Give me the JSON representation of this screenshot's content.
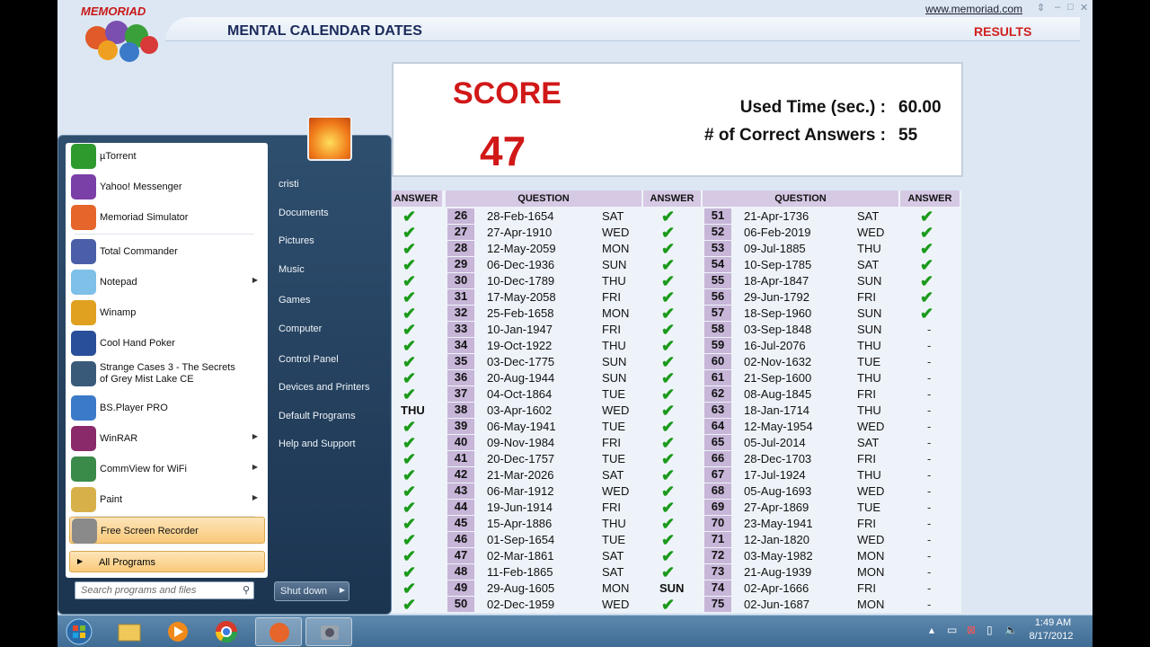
{
  "app": {
    "logo_text": "MEMORIAD",
    "title": "MENTAL CALENDAR DATES",
    "results_label": "RESULTS",
    "site_link": "www.memoriad.com"
  },
  "score": {
    "label": "SCORE",
    "value": "47",
    "time_label": "Used Time (sec.) :",
    "time_value": "60.00",
    "correct_label": "# of Correct Answers :",
    "correct_value": "55"
  },
  "table": {
    "headers": [
      "ANSWER",
      "QUESTION",
      "ANSWER",
      "QUESTION",
      "ANSWER"
    ],
    "rows": [
      {
        "a1": "✔",
        "n1": "26",
        "d1": "28-Feb-1654",
        "w1": "SAT",
        "a2": "✔",
        "n2": "51",
        "d2": "21-Apr-1736",
        "w2": "SAT",
        "a3": "✔"
      },
      {
        "a1": "✔",
        "n1": "27",
        "d1": "27-Apr-1910",
        "w1": "WED",
        "a2": "✔",
        "n2": "52",
        "d2": "06-Feb-2019",
        "w2": "WED",
        "a3": "✔"
      },
      {
        "a1": "✔",
        "n1": "28",
        "d1": "12-May-2059",
        "w1": "MON",
        "a2": "✔",
        "n2": "53",
        "d2": "09-Jul-1885",
        "w2": "THU",
        "a3": "✔"
      },
      {
        "a1": "✔",
        "n1": "29",
        "d1": "06-Dec-1936",
        "w1": "SUN",
        "a2": "✔",
        "n2": "54",
        "d2": "10-Sep-1785",
        "w2": "SAT",
        "a3": "✔"
      },
      {
        "a1": "✔",
        "n1": "30",
        "d1": "10-Dec-1789",
        "w1": "THU",
        "a2": "✔",
        "n2": "55",
        "d2": "18-Apr-1847",
        "w2": "SUN",
        "a3": "✔"
      },
      {
        "a1": "✔",
        "n1": "31",
        "d1": "17-May-2058",
        "w1": "FRI",
        "a2": "✔",
        "n2": "56",
        "d2": "29-Jun-1792",
        "w2": "FRI",
        "a3": "✔"
      },
      {
        "a1": "✔",
        "n1": "32",
        "d1": "25-Feb-1658",
        "w1": "MON",
        "a2": "✔",
        "n2": "57",
        "d2": "18-Sep-1960",
        "w2": "SUN",
        "a3": "✔"
      },
      {
        "a1": "✔",
        "n1": "33",
        "d1": "10-Jan-1947",
        "w1": "FRI",
        "a2": "✔",
        "n2": "58",
        "d2": "03-Sep-1848",
        "w2": "SUN",
        "a3": "-"
      },
      {
        "a1": "✔",
        "n1": "34",
        "d1": "19-Oct-1922",
        "w1": "THU",
        "a2": "✔",
        "n2": "59",
        "d2": "16-Jul-2076",
        "w2": "THU",
        "a3": "-"
      },
      {
        "a1": "✔",
        "n1": "35",
        "d1": "03-Dec-1775",
        "w1": "SUN",
        "a2": "✔",
        "n2": "60",
        "d2": "02-Nov-1632",
        "w2": "TUE",
        "a3": "-"
      },
      {
        "a1": "✔",
        "n1": "36",
        "d1": "20-Aug-1944",
        "w1": "SUN",
        "a2": "✔",
        "n2": "61",
        "d2": "21-Sep-1600",
        "w2": "THU",
        "a3": "-"
      },
      {
        "a1": "✔",
        "n1": "37",
        "d1": "04-Oct-1864",
        "w1": "TUE",
        "a2": "✔",
        "n2": "62",
        "d2": "08-Aug-1845",
        "w2": "FRI",
        "a3": "-"
      },
      {
        "a1": "THU",
        "n1": "38",
        "d1": "03-Apr-1602",
        "w1": "WED",
        "a2": "✔",
        "n2": "63",
        "d2": "18-Jan-1714",
        "w2": "THU",
        "a3": "-"
      },
      {
        "a1": "✔",
        "n1": "39",
        "d1": "06-May-1941",
        "w1": "TUE",
        "a2": "✔",
        "n2": "64",
        "d2": "12-May-1954",
        "w2": "WED",
        "a3": "-"
      },
      {
        "a1": "✔",
        "n1": "40",
        "d1": "09-Nov-1984",
        "w1": "FRI",
        "a2": "✔",
        "n2": "65",
        "d2": "05-Jul-2014",
        "w2": "SAT",
        "a3": "-"
      },
      {
        "a1": "✔",
        "n1": "41",
        "d1": "20-Dec-1757",
        "w1": "TUE",
        "a2": "✔",
        "n2": "66",
        "d2": "28-Dec-1703",
        "w2": "FRI",
        "a3": "-"
      },
      {
        "a1": "✔",
        "n1": "42",
        "d1": "21-Mar-2026",
        "w1": "SAT",
        "a2": "✔",
        "n2": "67",
        "d2": "17-Jul-1924",
        "w2": "THU",
        "a3": "-"
      },
      {
        "a1": "✔",
        "n1": "43",
        "d1": "06-Mar-1912",
        "w1": "WED",
        "a2": "✔",
        "n2": "68",
        "d2": "05-Aug-1693",
        "w2": "WED",
        "a3": "-"
      },
      {
        "a1": "✔",
        "n1": "44",
        "d1": "19-Jun-1914",
        "w1": "FRI",
        "a2": "✔",
        "n2": "69",
        "d2": "27-Apr-1869",
        "w2": "TUE",
        "a3": "-"
      },
      {
        "a1": "✔",
        "n1": "45",
        "d1": "15-Apr-1886",
        "w1": "THU",
        "a2": "✔",
        "n2": "70",
        "d2": "23-May-1941",
        "w2": "FRI",
        "a3": "-"
      },
      {
        "a1": "✔",
        "n1": "46",
        "d1": "01-Sep-1654",
        "w1": "TUE",
        "a2": "✔",
        "n2": "71",
        "d2": "12-Jan-1820",
        "w2": "WED",
        "a3": "-"
      },
      {
        "a1": "✔",
        "n1": "47",
        "d1": "02-Mar-1861",
        "w1": "SAT",
        "a2": "✔",
        "n2": "72",
        "d2": "03-May-1982",
        "w2": "MON",
        "a3": "-"
      },
      {
        "a1": "✔",
        "n1": "48",
        "d1": "11-Feb-1865",
        "w1": "SAT",
        "a2": "✔",
        "n2": "73",
        "d2": "21-Aug-1939",
        "w2": "MON",
        "a3": "-"
      },
      {
        "a1": "✔",
        "n1": "49",
        "d1": "29-Aug-1605",
        "w1": "MON",
        "a2": "SUN",
        "n2": "74",
        "d2": "02-Apr-1666",
        "w2": "FRI",
        "a3": "-"
      },
      {
        "a1": "✔",
        "n1": "50",
        "d1": "02-Dec-1959",
        "w1": "WED",
        "a2": "✔",
        "n2": "75",
        "d2": "02-Jun-1687",
        "w2": "MON",
        "a3": "-"
      }
    ]
  },
  "start_menu": {
    "pinned": [
      {
        "label": "µTorrent",
        "icon": "utorrent-icon",
        "color": "#2e9a2e"
      },
      {
        "label": "Yahoo! Messenger",
        "icon": "yahoo-messenger-icon",
        "color": "#7b3fa8"
      },
      {
        "label": "Memoriad Simulator",
        "icon": "memoriad-brain-icon",
        "color": "#e5652a"
      },
      {
        "label": "Total Commander",
        "icon": "floppy-disk-icon",
        "color": "#4a5fa8"
      },
      {
        "label": "Notepad",
        "icon": "notepad-icon",
        "color": "#7ec0e8",
        "submenu": true
      },
      {
        "label": "Winamp",
        "icon": "winamp-icon",
        "color": "#e0a020"
      },
      {
        "label": "Cool Hand Poker",
        "icon": "poker-icon",
        "color": "#2a4f9a"
      },
      {
        "label": "Strange Cases 3 - The Secrets of Grey Mist Lake CE",
        "icon": "magnifier-game-icon",
        "color": "#3a5a7a"
      },
      {
        "label": "BS.Player PRO",
        "icon": "bsplayer-icon",
        "color": "#3a7ac8"
      },
      {
        "label": "WinRAR",
        "icon": "winrar-icon",
        "color": "#8a2a6a",
        "submenu": true
      },
      {
        "label": "CommView for WiFi",
        "icon": "commview-icon",
        "color": "#3a8a4a",
        "submenu": true
      },
      {
        "label": "Paint",
        "icon": "paint-palette-icon",
        "color": "#d8b04a",
        "submenu": true
      },
      {
        "label": "Free Screen Recorder",
        "icon": "camera-icon",
        "color": "#8a8a8a"
      }
    ],
    "all_programs": "All Programs",
    "search_placeholder": "Search programs and files",
    "right": [
      "cristi",
      "Documents",
      "Pictures",
      "Music",
      "Games",
      "Computer",
      "Control Panel",
      "Devices and Printers",
      "Default Programs",
      "Help and Support"
    ],
    "shutdown": "Shut down"
  },
  "taskbar": {
    "time": "1:49 AM",
    "date": "8/17/2012",
    "apps": [
      "windows-start-orb-icon",
      "file-explorer-icon",
      "media-player-icon",
      "chrome-icon",
      "memoriad-brain-icon",
      "screen-recorder-icon"
    ]
  }
}
